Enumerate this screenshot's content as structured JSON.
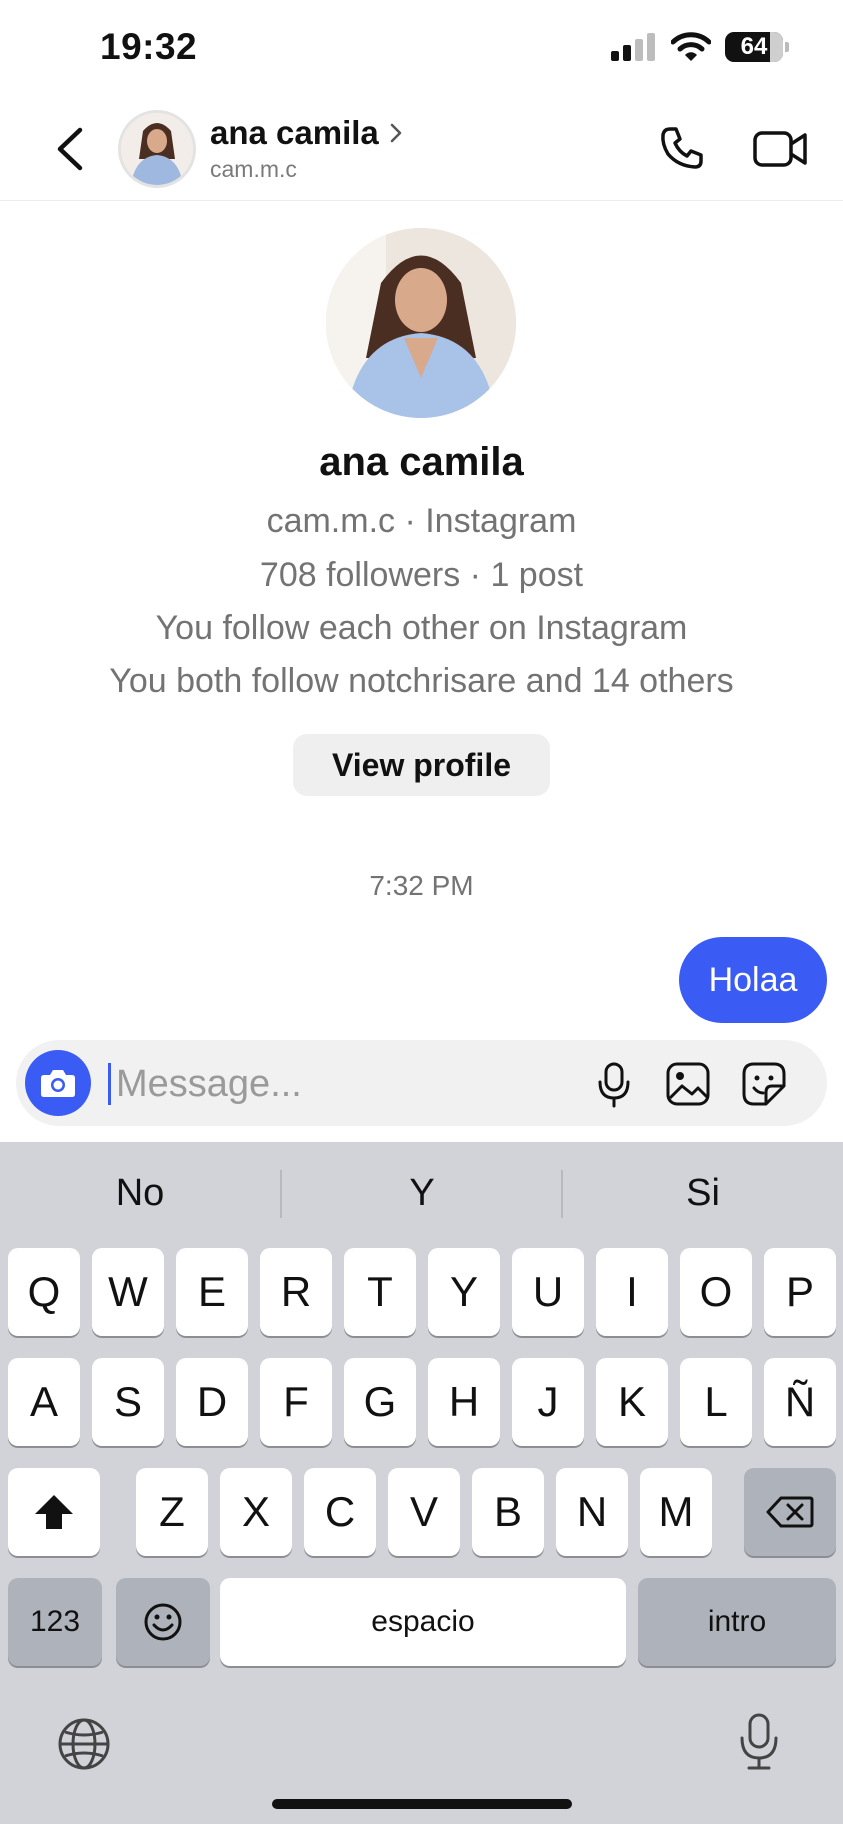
{
  "status_bar": {
    "time": "19:32",
    "battery": "64"
  },
  "header": {
    "name": "ana camila",
    "handle": "cam.m.c"
  },
  "profile": {
    "name": "ana camila",
    "subtitle": "cam.m.c · Instagram",
    "followers_line": "708 followers · 1 post",
    "mutual_line": "You follow each other on Instagram",
    "both_follow_line": "You both follow notchrisare and 14 others",
    "view_profile_label": "View profile"
  },
  "chat": {
    "timestamp": "7:32 PM",
    "messages": [
      {
        "from": "me",
        "text": "Holaa"
      }
    ]
  },
  "composer": {
    "placeholder": "Message..."
  },
  "keyboard": {
    "suggestions": [
      "No",
      "Y",
      "Si"
    ],
    "row1": [
      "Q",
      "W",
      "E",
      "R",
      "T",
      "Y",
      "U",
      "I",
      "O",
      "P"
    ],
    "row2": [
      "A",
      "S",
      "D",
      "F",
      "G",
      "H",
      "J",
      "K",
      "L",
      "Ñ"
    ],
    "row3": [
      "Z",
      "X",
      "C",
      "V",
      "B",
      "N",
      "M"
    ],
    "numbers_label": "123",
    "space_label": "espacio",
    "return_label": "intro"
  },
  "colors": {
    "accent": "#3b5bf5",
    "keyboard_bg": "#d1d3d9",
    "secondary_text": "#737373"
  }
}
